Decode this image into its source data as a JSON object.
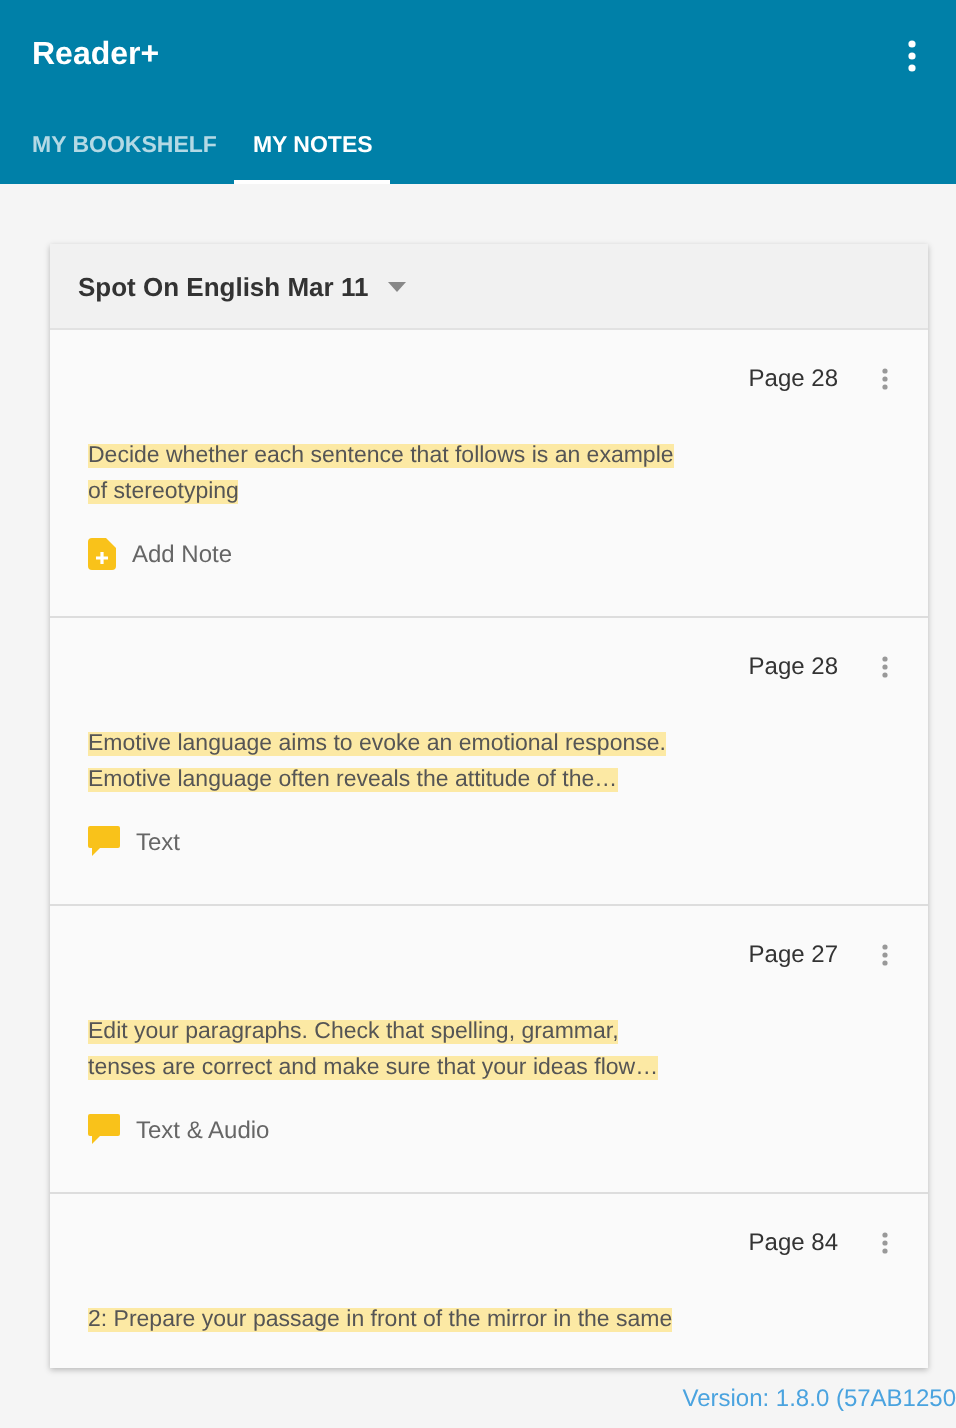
{
  "app_bar": {
    "title": "Reader+"
  },
  "tabs": [
    {
      "label": "MY BOOKSHELF",
      "selected": false
    },
    {
      "label": "MY NOTES",
      "selected": true
    }
  ],
  "notes_card": {
    "book": "Spot On English Mar 11",
    "notes": [
      {
        "page": "Page 28",
        "highlight": "Decide whether each sentence that follows is an example of stereotyping",
        "kind": "add_note",
        "footer": "Add Note"
      },
      {
        "page": "Page 28",
        "highlight": "Emotive language aims to evoke an emotional response. Emotive language often reveals the attitude of the…",
        "kind": "text",
        "footer": "Text"
      },
      {
        "page": "Page 27",
        "highlight": "Edit your paragraphs. Check that spelling, grammar, tenses are correct and make sure that your ideas flow…",
        "kind": "text_audio",
        "footer": "Text & Audio"
      },
      {
        "page": "Page 84",
        "highlight": "2: Prepare your passage in front of the mirror in the same"
      }
    ]
  },
  "version": "Version: 1.8.0 (57AB1250"
}
